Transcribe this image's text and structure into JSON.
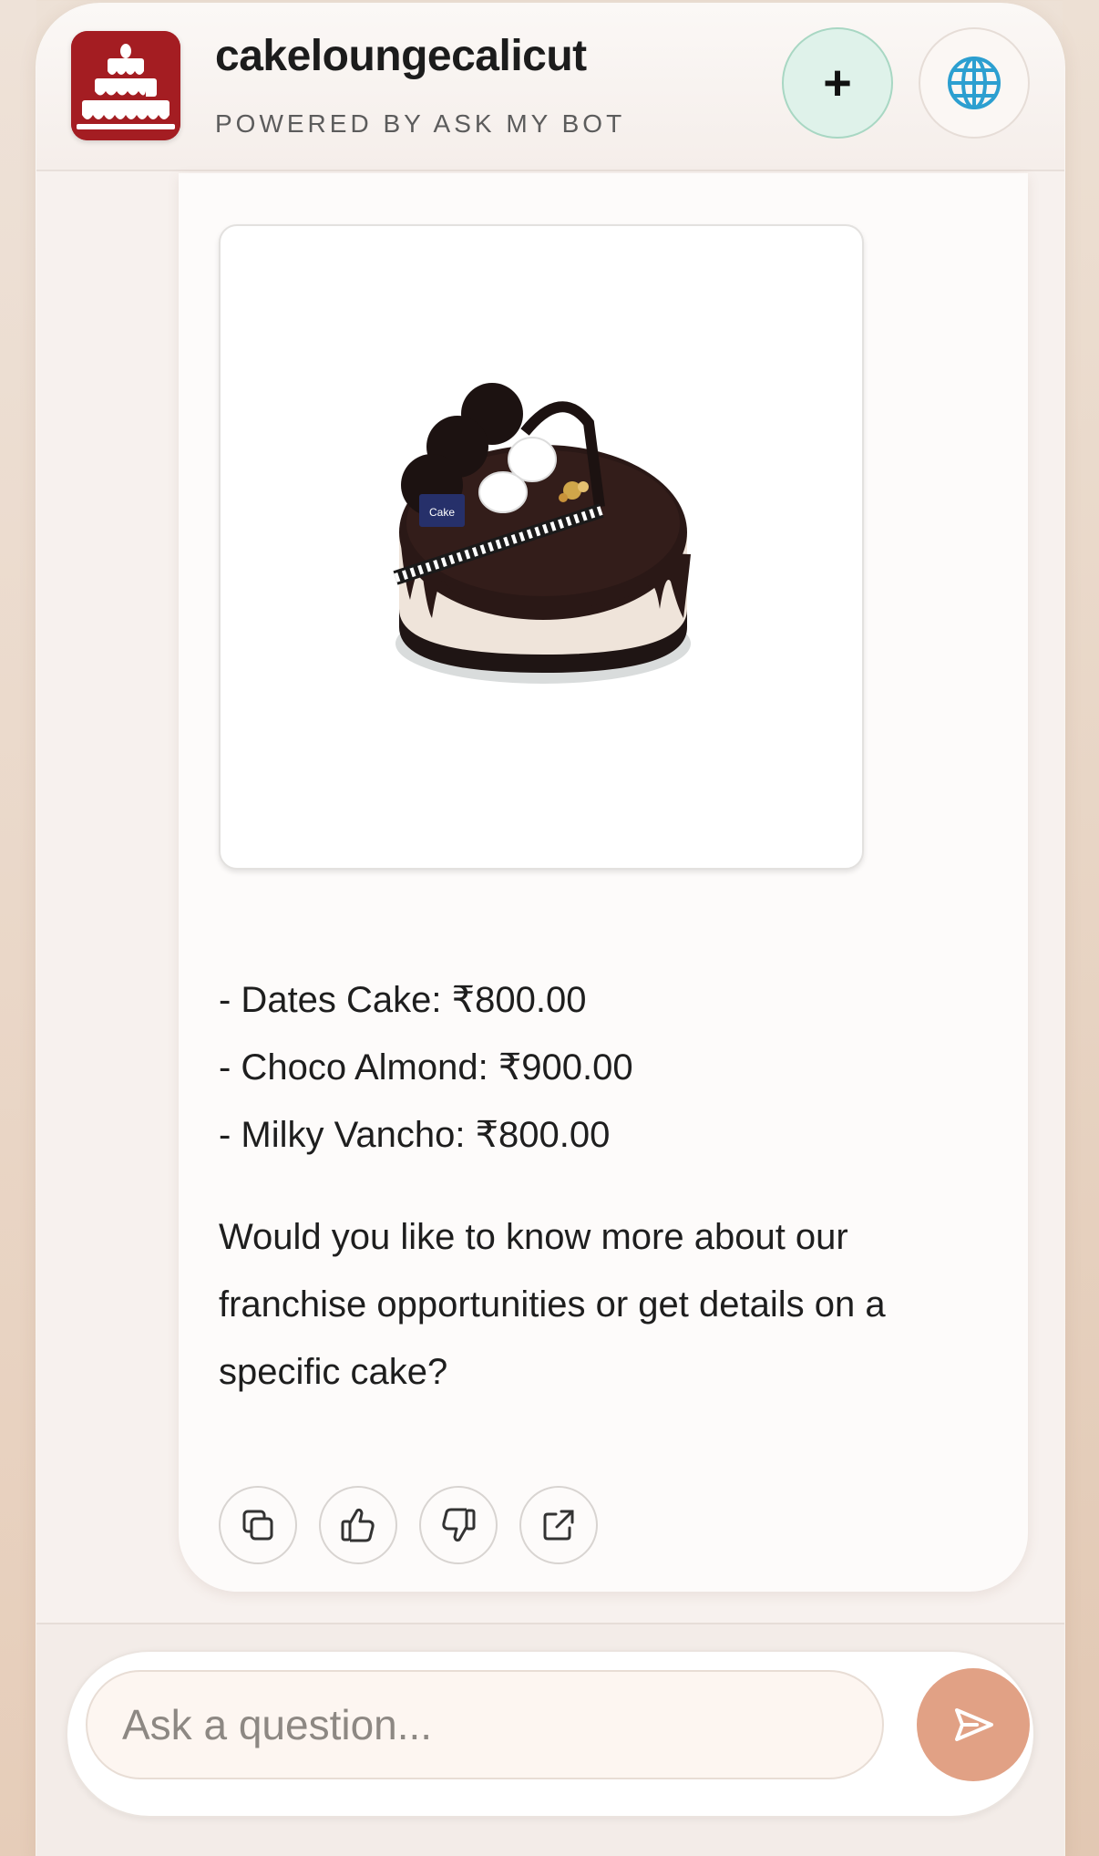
{
  "header": {
    "brand_name": "cakeloungecalicut",
    "brand_sub": "POWERED BY ASK MY BOT",
    "new_chat_label": "+",
    "logo_icon": "cake-logo-icon",
    "language_icon": "globe-icon"
  },
  "message": {
    "product_image_label": "Cake",
    "prices": [
      "- Dates Cake: ₹800.00",
      "- Choco Almond: ₹900.00",
      "- Milky Vancho: ₹800.00"
    ],
    "question": "Would you like to know more about our franchise opportunities or get details on a specific cake?",
    "actions": [
      "copy-icon",
      "thumbs-up-icon",
      "thumbs-down-icon",
      "external-link-icon"
    ]
  },
  "composer": {
    "placeholder": "Ask a question...",
    "send_icon": "send-icon"
  },
  "colors": {
    "brand_red": "#a41d22",
    "accent_mint": "#dff2ea",
    "send_button": "#e1a185"
  }
}
